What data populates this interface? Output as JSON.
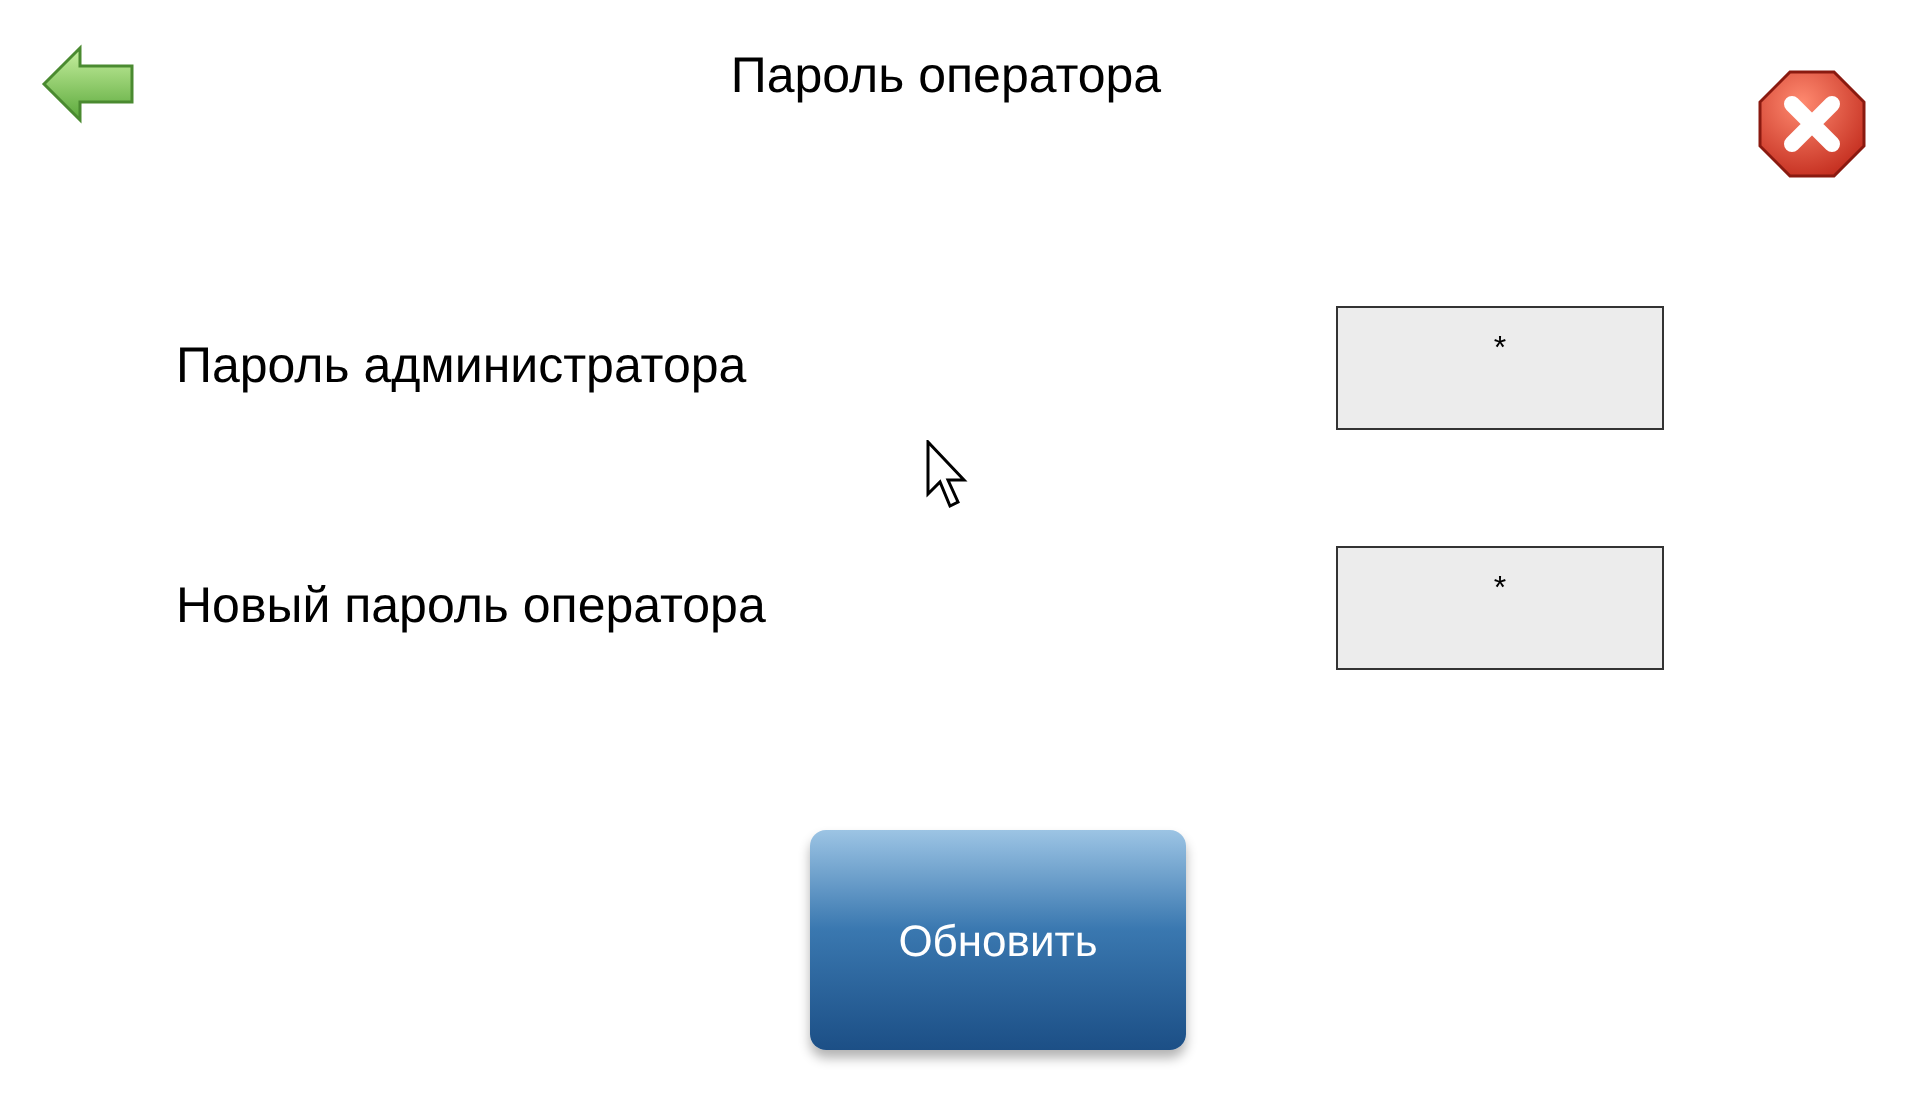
{
  "window": {
    "title": "Пароль оператора"
  },
  "fields": [
    {
      "label": "Пароль администратора",
      "value": "*"
    },
    {
      "label": "Новый пароль оператора",
      "value": "*"
    }
  ],
  "button": {
    "label": "Обновить"
  }
}
